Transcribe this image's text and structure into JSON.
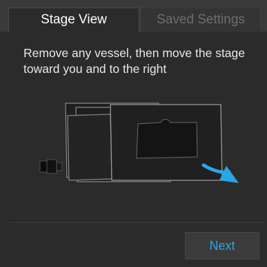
{
  "tabs": [
    {
      "label": "Stage View",
      "active": true
    },
    {
      "label": "Saved Settings",
      "active": false
    }
  ],
  "instruction": "Remove any vessel, then move the stage toward you and to the right",
  "footer": {
    "next_label": "Next"
  },
  "colors": {
    "background": "#2b2b2b",
    "accent": "#29a6e8",
    "text": "#e8e8e8",
    "inactive_tab_text": "#6e6e6e"
  },
  "icons": {
    "illustration": "microscope-stage-illustration",
    "direction": "curved-arrow-icon"
  }
}
